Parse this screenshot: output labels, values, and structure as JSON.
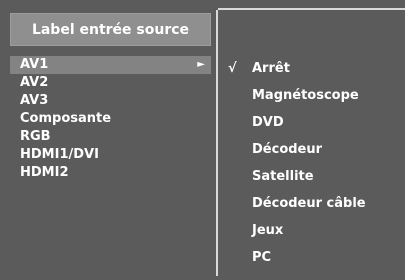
{
  "menu": {
    "title": "Label entrée source",
    "sources": [
      {
        "label": "AV1"
      },
      {
        "label": "AV2"
      },
      {
        "label": "AV3"
      },
      {
        "label": "Composante"
      },
      {
        "label": "RGB"
      },
      {
        "label": "HDMI1/DVI"
      },
      {
        "label": "HDMI2"
      }
    ],
    "selected_source": "AV1",
    "submenu_arrow": "►",
    "check_mark": "√",
    "options": [
      {
        "label": "Arrêt"
      },
      {
        "label": "Magnétoscope"
      },
      {
        "label": "DVD"
      },
      {
        "label": "Décodeur"
      },
      {
        "label": "Satellite"
      },
      {
        "label": "Décodeur câble"
      },
      {
        "label": "Jeux"
      },
      {
        "label": "PC"
      }
    ],
    "checked_option": "Arrêt"
  },
  "colors": {
    "panel": "#5b5b5b",
    "title_bar": "#8f8f8f",
    "selected_row": "#838383",
    "divider": "#d9d9d9",
    "text": "#ffffff"
  }
}
